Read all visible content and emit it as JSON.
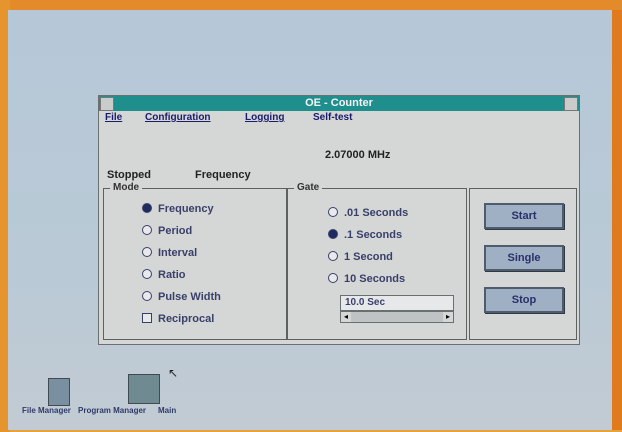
{
  "window": {
    "title": "OE - Counter",
    "menu": [
      "File",
      "Configuration",
      "Logging",
      "Self-test"
    ],
    "frequency_display": "2.07000 MHz",
    "status": "Stopped",
    "mode_label": "Frequency"
  },
  "mode_group": {
    "title": "Mode",
    "options": [
      "Frequency",
      "Period",
      "Interval",
      "Ratio",
      "Pulse Width"
    ],
    "selected_index": 0,
    "checkbox_label": "Reciprocal"
  },
  "gate_group": {
    "title": "Gate",
    "options": [
      ".01 Seconds",
      ".1 Seconds",
      "1 Second",
      "10 Seconds"
    ],
    "selected_index": 1,
    "custom_value": "10.0 Sec"
  },
  "buttons": {
    "start": "Start",
    "single": "Single",
    "stop": "Stop"
  },
  "desktop": {
    "icons": [
      "File Manager",
      "Program Manager",
      "Main"
    ]
  },
  "colors": {
    "titlebar": "#1f8f8e",
    "button": "#9fb0c4"
  }
}
